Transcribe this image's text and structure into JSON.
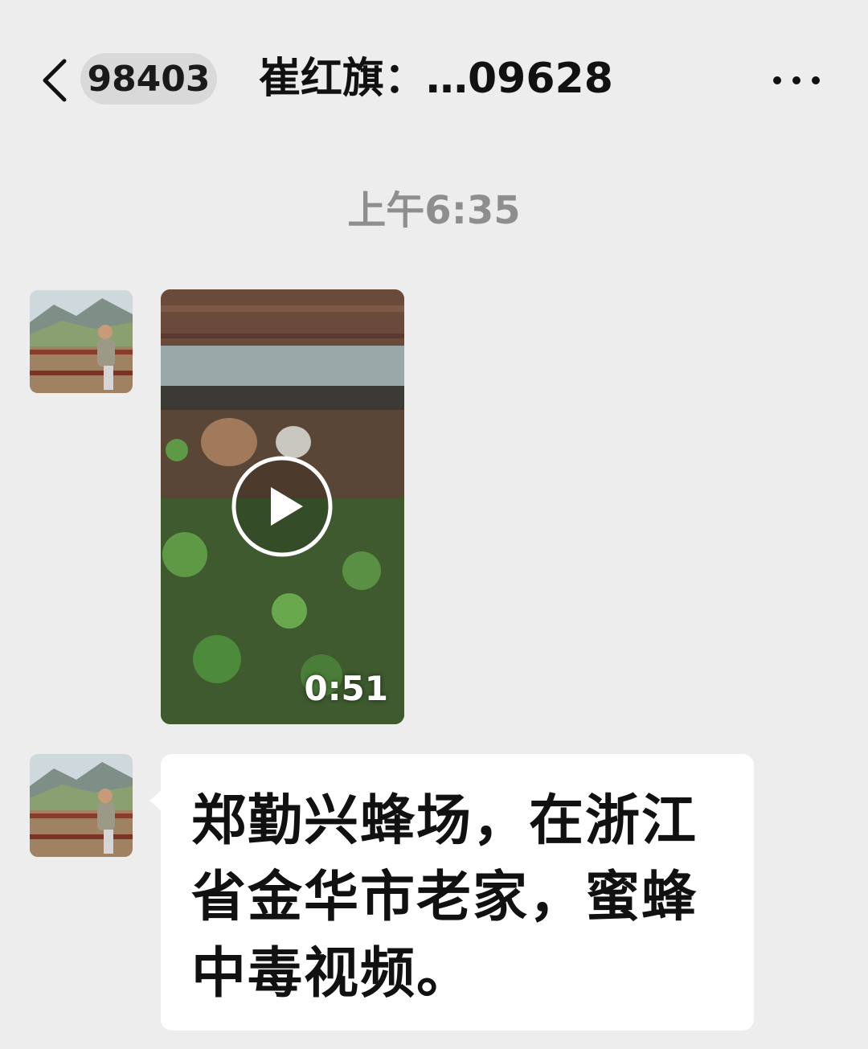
{
  "header": {
    "unread_count": "98403",
    "title": "崔红旗：…09628"
  },
  "chat": {
    "timestamp": "上午6:35",
    "messages": [
      {
        "type": "video",
        "duration": "0:51"
      },
      {
        "type": "text",
        "text": "郑勤兴蜂场，在浙江省金华市老家，蜜蜂中毒视频。"
      }
    ]
  },
  "icons": {
    "back": "chevron-left-icon",
    "more": "more-dots-icon",
    "play": "play-icon"
  },
  "colors": {
    "background": "#ededed",
    "bubble": "#ffffff",
    "badge": "#d9d9d9",
    "timestamp": "#8e8e8e"
  }
}
